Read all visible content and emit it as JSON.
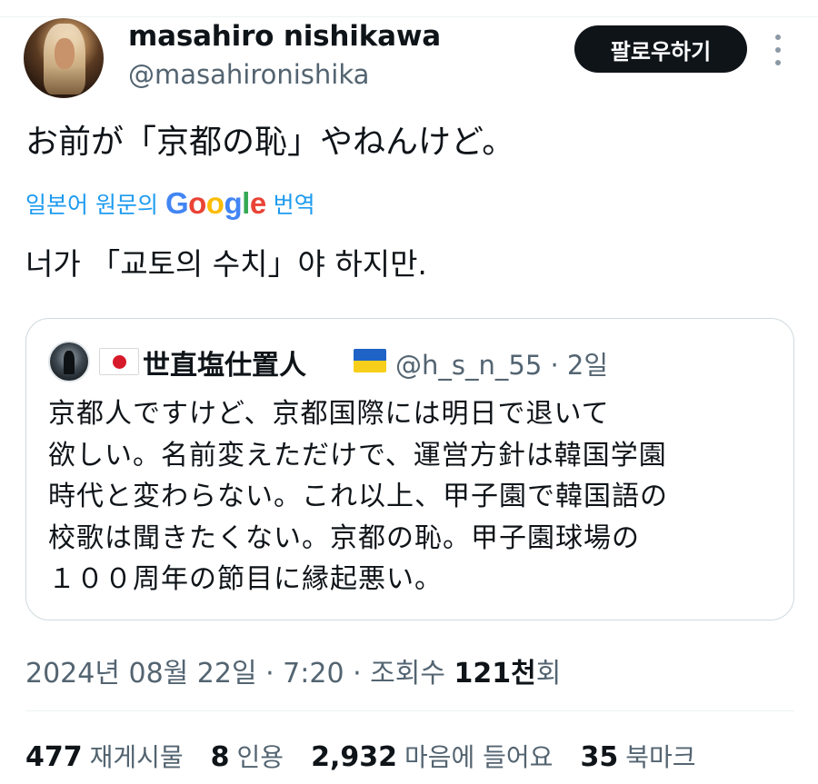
{
  "author": {
    "display_name": "masahiro nishikawa",
    "handle": "@masahironishika"
  },
  "follow_label": "팔로우하기",
  "tweet": {
    "text": "お前が「京都の恥」やねんけど。",
    "translate_prefix": "일본어 원문의",
    "translate_suffix": "번역",
    "google_parts": [
      "G",
      "o",
      "o",
      "g",
      "l",
      "e"
    ],
    "translated_text": "너가 「교토의 수치」야 하지만."
  },
  "quote": {
    "name": "世直塩仕置人",
    "meta": "@h_s_n_55 · 2일",
    "body_lines": [
      "京都人ですけど、京都国際には明日で退いて",
      "欲しい。名前変えただけで、運営方針は韓国学園",
      "時代と変わらない。これ以上、甲子園で韓国語の",
      "校歌は聞きたくない。京都の恥。甲子園球場の",
      "１００周年の節目に縁起悪い。"
    ]
  },
  "timestamp": {
    "date_time": "2024년 08월 22일 · 7:20 · 조회수 ",
    "views_value": "121천",
    "views_suffix": "회"
  },
  "stats": [
    {
      "value": "477",
      "label": "재게시물"
    },
    {
      "value": "8",
      "label": "인용"
    },
    {
      "value": "2,932",
      "label": "마음에 들어요"
    },
    {
      "value": "35",
      "label": "북마크"
    }
  ],
  "colors": {
    "link_blue": "#1d9bf0",
    "secondary_text": "#536471",
    "follow_button_bg": "#0f1419"
  },
  "icons": {
    "more": "more-vertical-icon",
    "jp_flag": "japan-flag-icon",
    "ua_flag": "ukraine-flag-icon"
  }
}
